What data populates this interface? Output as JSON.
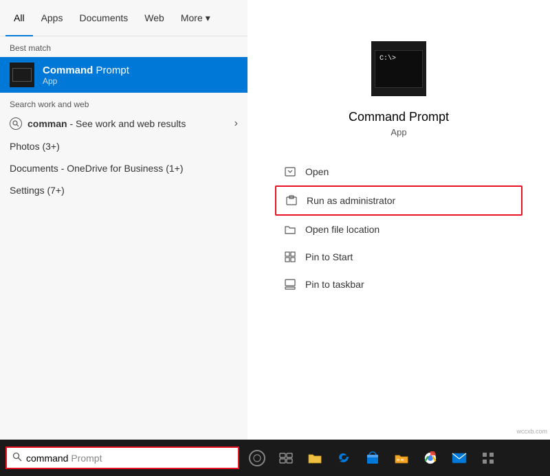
{
  "tabs": {
    "items": [
      {
        "label": "All",
        "active": true
      },
      {
        "label": "Apps",
        "active": false
      },
      {
        "label": "Documents",
        "active": false
      },
      {
        "label": "Web",
        "active": false
      },
      {
        "label": "More",
        "active": false,
        "hasDropdown": true
      }
    ]
  },
  "left_panel": {
    "best_match_label": "Best match",
    "best_match": {
      "title_bold": "Command",
      "title_rest": " Prompt",
      "subtitle": "App"
    },
    "search_web_label": "Search work and web",
    "search_web_item": {
      "query": "comman",
      "suffix": " - See work and web results"
    },
    "results": [
      {
        "label": "Photos (3+)"
      },
      {
        "label": "Documents - OneDrive for Business (1+)"
      },
      {
        "label": "Settings (7+)"
      }
    ]
  },
  "right_panel": {
    "app_name": "Command Prompt",
    "app_type": "App",
    "actions": [
      {
        "label": "Open",
        "icon": "open-icon"
      },
      {
        "label": "Run as administrator",
        "icon": "admin-icon",
        "highlighted": true
      },
      {
        "label": "Open file location",
        "icon": "folder-icon"
      },
      {
        "label": "Pin to Start",
        "icon": "pin-start-icon"
      },
      {
        "label": "Pin to taskbar",
        "icon": "pin-taskbar-icon"
      }
    ]
  },
  "taskbar": {
    "search_typed": "command",
    "search_placeholder": " Prompt",
    "icons": [
      {
        "name": "cortana",
        "label": ""
      },
      {
        "name": "task-view",
        "label": "⧉"
      },
      {
        "name": "file-explorer",
        "label": "📁"
      },
      {
        "name": "edge",
        "label": ""
      },
      {
        "name": "store",
        "label": ""
      },
      {
        "name": "folder",
        "label": ""
      },
      {
        "name": "chrome",
        "label": ""
      },
      {
        "name": "mail",
        "label": ""
      },
      {
        "name": "more",
        "label": ""
      }
    ]
  },
  "watermark": "wccxb.com"
}
